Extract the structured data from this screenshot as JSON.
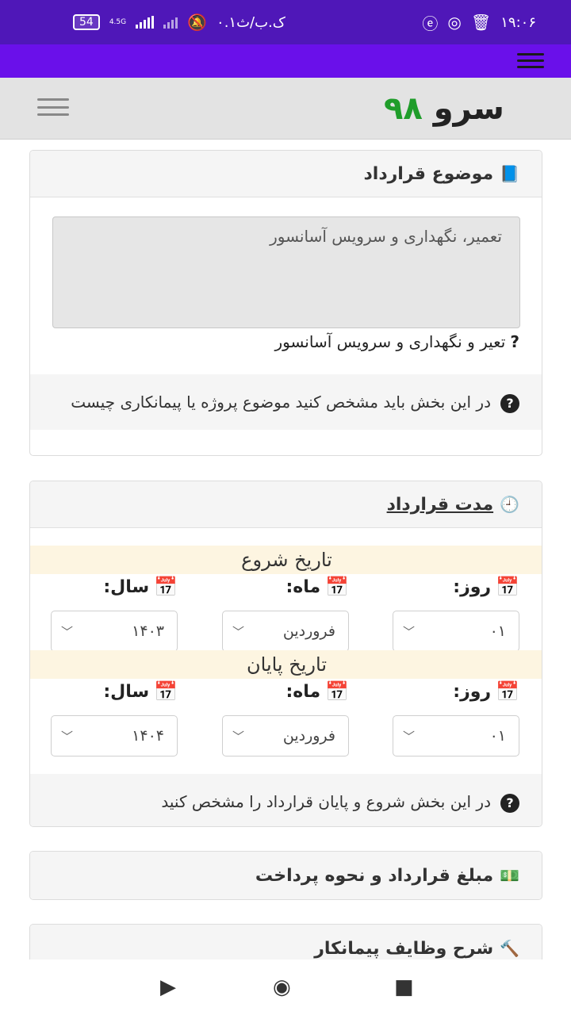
{
  "status_bar": {
    "time": "۱۹:۰۶",
    "carrier": "۰.۱ک.ب/ث",
    "battery": "54",
    "network": "4.5G",
    "icons": [
      "bell-off-icon",
      "signal-icon",
      "instagram-icon",
      "trash-icon",
      "app-icon"
    ]
  },
  "colors": {
    "status_bar": "#4f17b8",
    "app_bar": "#6a10ea",
    "logo_number": "#1f9d2a",
    "band": "#fdf5e1"
  },
  "header": {
    "logo_word": "سرو",
    "logo_number": "۹۸"
  },
  "contract_subject": {
    "title": "موضوع قرارداد",
    "textarea_value": "تعمیر، نگهداری و سرویس آسانسور",
    "hint": "تعیر و نگهداری و سرویس آسانسور",
    "hint_mark": "?",
    "help": "در این بخش باید مشخص کنید موضوع پروژه یا پیمانکاری چیست"
  },
  "contract_duration": {
    "title": "مدت قرارداد",
    "start_label": "تاریخ شروع",
    "end_label": "تاریخ پایان",
    "day_label": "روز:",
    "month_label": "ماه:",
    "year_label": "سال:",
    "start": {
      "day": "۰۱",
      "month": "فروردین",
      "year": "۱۴۰۳"
    },
    "end": {
      "day": "۰۱",
      "month": "فروردین",
      "year": "۱۴۰۴"
    },
    "help": "در این بخش شروع و پایان قرارداد را مشخص کنید"
  },
  "contract_amount": {
    "title": "مبلغ قرارداد و نحوه پرداخت"
  },
  "contractor_duties": {
    "title": "شرح وظایف پیمانکار"
  },
  "nav": {
    "back": "▶",
    "home": "◉",
    "recents": "■"
  }
}
